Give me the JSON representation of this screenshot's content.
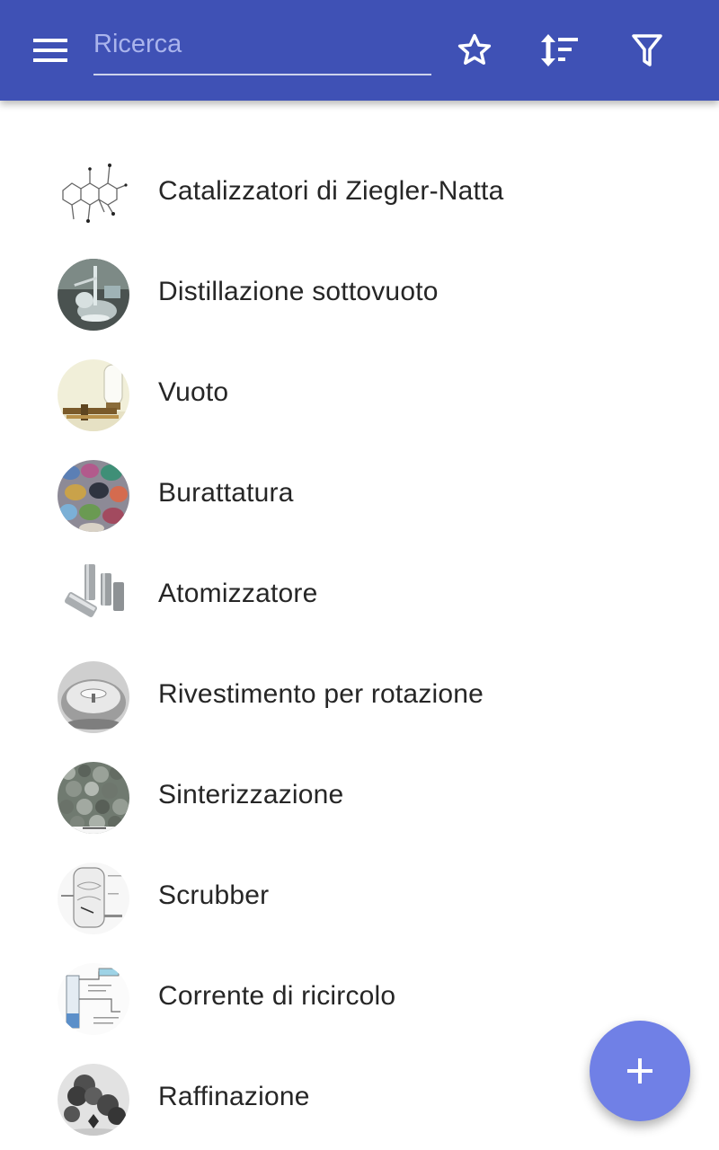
{
  "header": {
    "search": {
      "placeholder": "Ricerca",
      "value": ""
    },
    "icons": {
      "menu": "menu-icon",
      "favorites": "star-outline-icon",
      "sort": "sort-icon",
      "filter": "filter-icon"
    },
    "colors": {
      "background": "#3f51b5",
      "placeholder": "#aab4ec",
      "icon": "#ffffff"
    }
  },
  "list": {
    "items": [
      {
        "label": "Catalizzatori di Ziegler-Natta",
        "thumb": "molecule-structure"
      },
      {
        "label": "Distillazione sottovuoto",
        "thumb": "lab-glassware"
      },
      {
        "label": "Vuoto",
        "thumb": "vacuum-pump"
      },
      {
        "label": "Burattatura",
        "thumb": "tumbled-stones"
      },
      {
        "label": "Atomizzatore",
        "thumb": "metal-nozzles"
      },
      {
        "label": "Rivestimento per rotazione",
        "thumb": "spin-coater"
      },
      {
        "label": "Sinterizzazione",
        "thumb": "sinter-pellets"
      },
      {
        "label": "Scrubber",
        "thumb": "scrubber-diagram"
      },
      {
        "label": "Corrente di ricircolo",
        "thumb": "recycle-diagram"
      },
      {
        "label": "Raffinazione",
        "thumb": "refined-metal"
      }
    ]
  },
  "fab": {
    "icon": "plus-icon",
    "color": "#7080e6"
  }
}
